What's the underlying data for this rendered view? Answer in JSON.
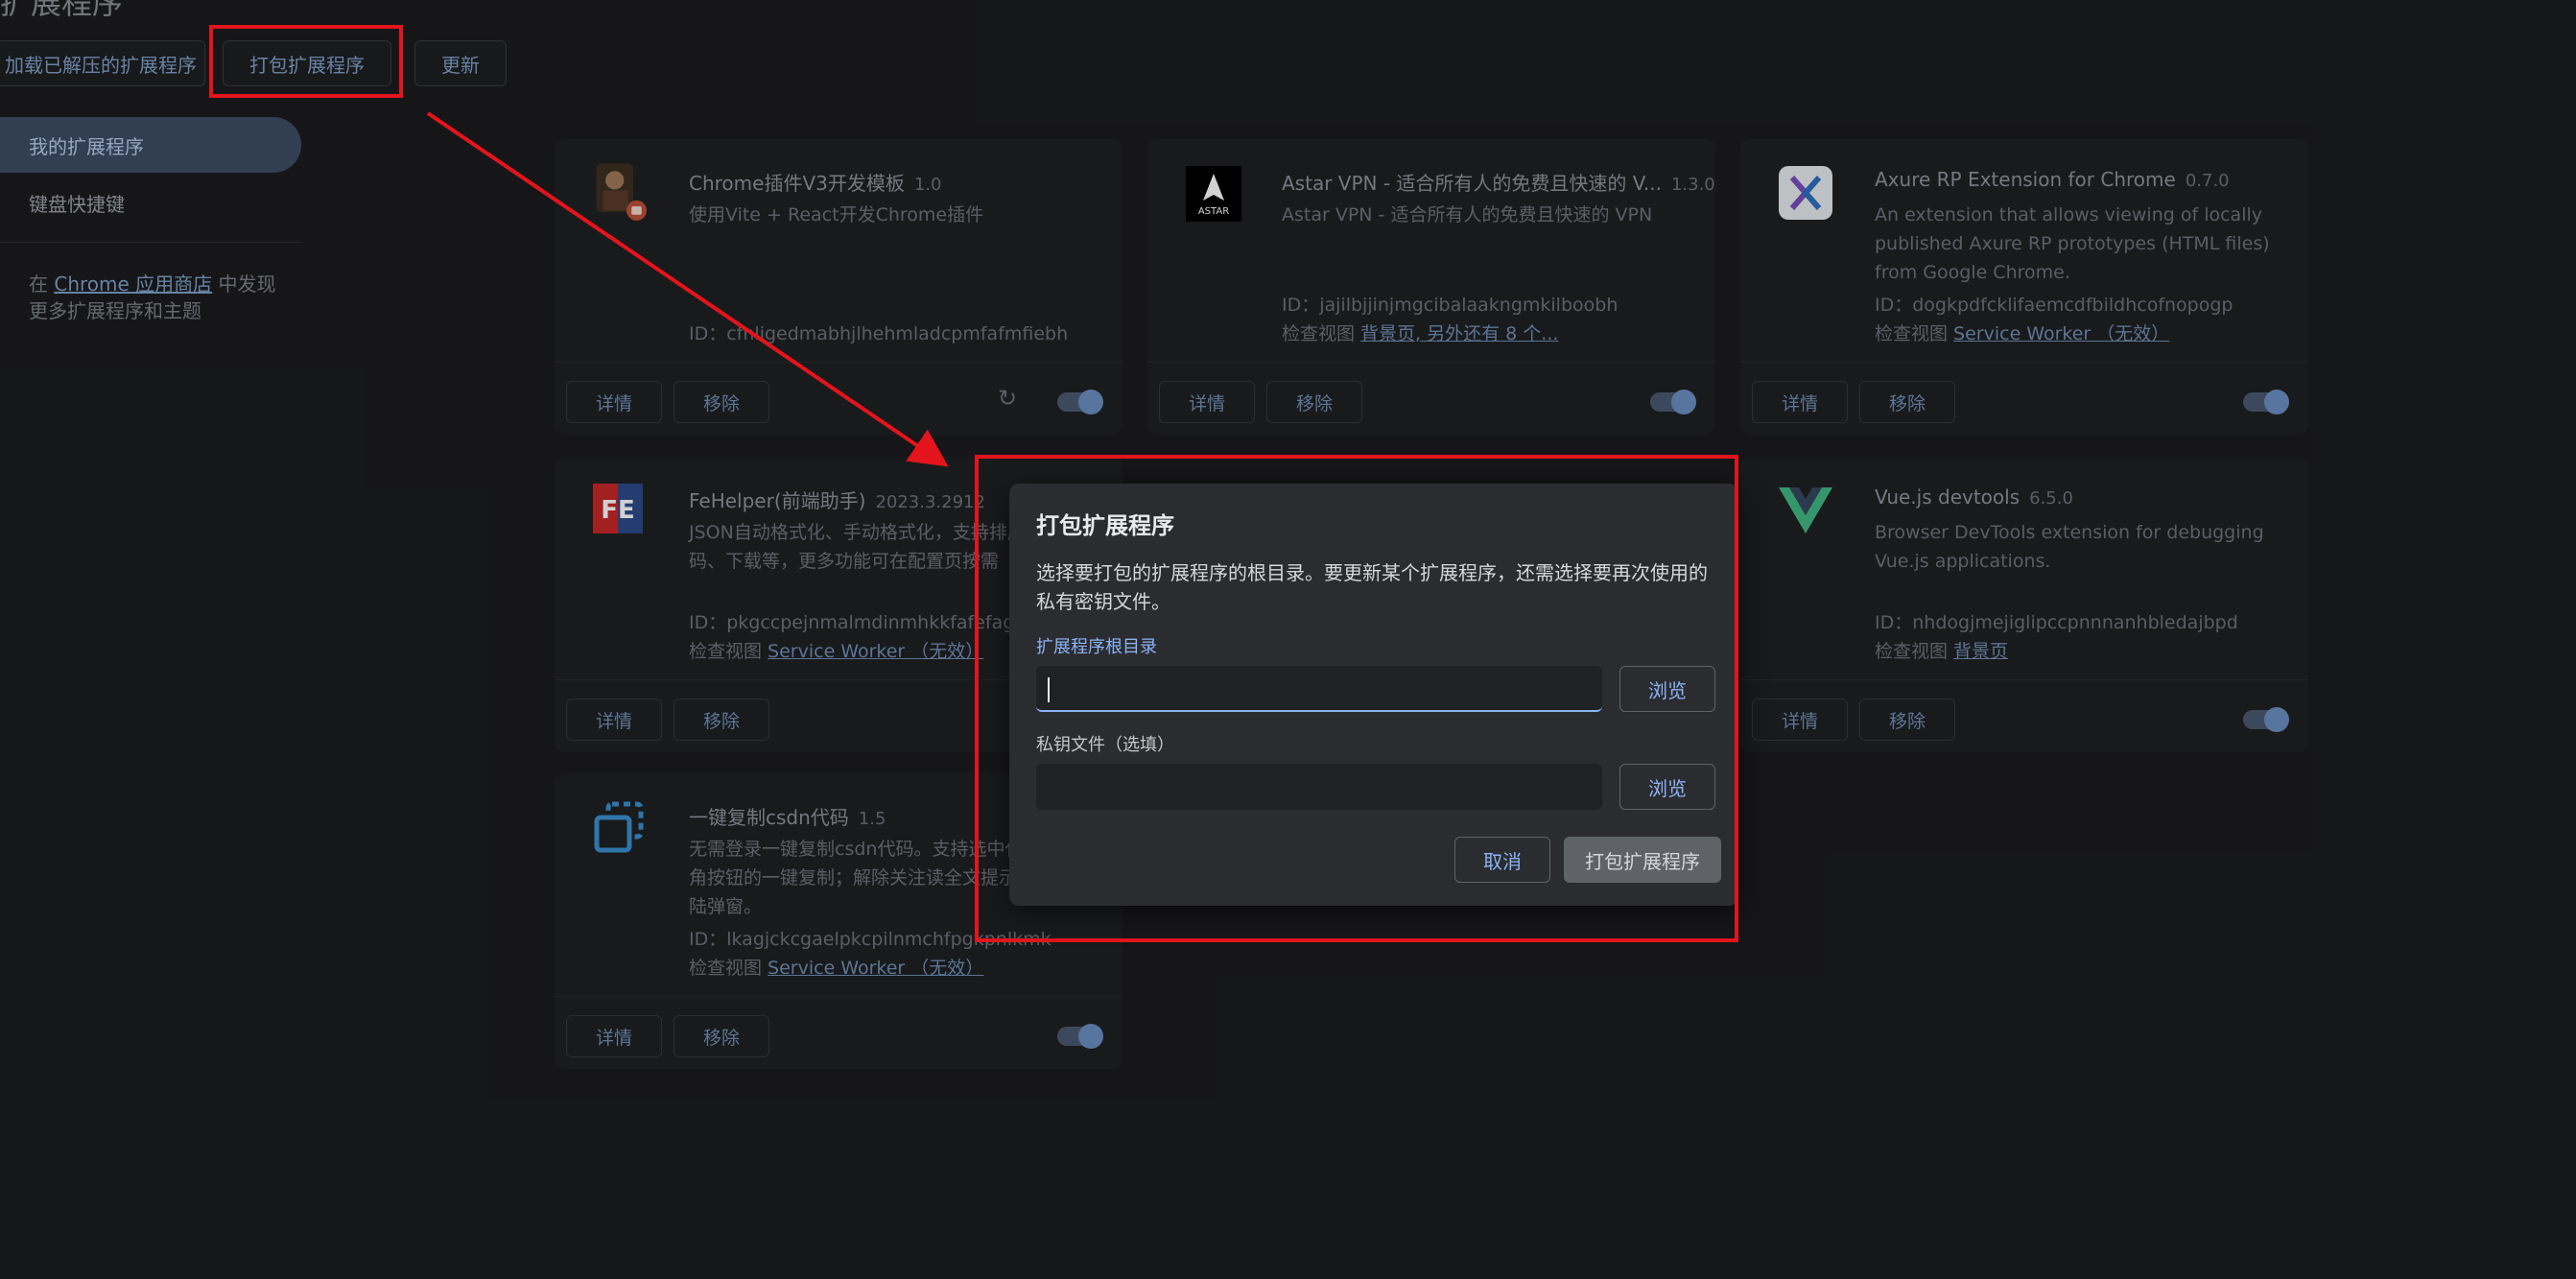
{
  "page": {
    "title": "扩展程序"
  },
  "toolbar": {
    "load_unpacked": "加载已解压的扩展程序",
    "pack_extension": "打包扩展程序",
    "update": "更新"
  },
  "sidebar": {
    "items": [
      {
        "label": "我的扩展程序"
      },
      {
        "label": "键盘快捷键"
      }
    ],
    "note_prefix": "在 ",
    "note_link": "Chrome 应用商店",
    "note_suffix": " 中发现更多扩展程序和主题"
  },
  "card_labels": {
    "details": "详情",
    "remove": "移除",
    "id_prefix": "ID：",
    "inspect_prefix": "检查视图 "
  },
  "extensions": [
    {
      "name": "Chrome插件V3开发模板",
      "version": "1.0",
      "description": "使用Vite + React开发Chrome插件",
      "id": "cfnligedmabhjlhehmladcpmfafmfiebh",
      "views": "",
      "icon": "avatar-icon"
    },
    {
      "name": "Astar VPN - 适合所有人的免费且快速的 V...",
      "version": "1.3.0",
      "description": "Astar VPN - 适合所有人的免费且快速的 VPN",
      "id": "jajilbjjinjmgcibalaakngmkilboobh",
      "views": "背景页, 另外还有 8 个...",
      "icon": "astar-icon",
      "icon_text": "ASTAR"
    },
    {
      "name": "Axure RP Extension for Chrome",
      "version": "0.7.0",
      "description": "An extension that allows viewing of locally published Axure RP prototypes (HTML files) from Google Chrome.",
      "id": "dogkpdfcklifaemcdfbildhcofnopogp",
      "views": "Service Worker （无效）",
      "icon": "axure-icon"
    },
    {
      "name": "FeHelper(前端助手)",
      "version": "2023.3.2912",
      "description": "JSON自动格式化、手动格式化，支持排序、解码、下载等，更多功能可在配置页按需",
      "id": "pkgccpejnmalmdinmhkkfafefagiiia",
      "views": "Service Worker （无效）",
      "icon": "fehelper-icon",
      "icon_text": "FE"
    },
    {
      "name": "Vue.js devtools",
      "version": "6.5.0",
      "description": "Browser DevTools extension for debugging Vue.js applications.",
      "id": "nhdogjmejiglipccpnnnanhbledajbpd",
      "views": "背景页",
      "icon": "vue-icon"
    },
    {
      "name": "一键复制csdn代码",
      "version": "1.5",
      "description": "无需登录一键复制csdn代码。支持选中代码右上角按钮的一键复制；解除关注读全文提示；去除登陆弹窗。",
      "id": "lkagjckcgaelpkcpilnmchfpgkpnlkmk",
      "views": "Service Worker （无效）",
      "icon": "csdn-copy-icon"
    }
  ],
  "dialog": {
    "title": "打包扩展程序",
    "description": "选择要打包的扩展程序的根目录。要更新某个扩展程序，还需选择要再次使用的私有密钥文件。",
    "root_label": "扩展程序根目录",
    "root_value": "",
    "key_label": "私钥文件（选填）",
    "key_value": "",
    "browse": "浏览",
    "cancel": "取消",
    "confirm": "打包扩展程序"
  },
  "colors": {
    "annotation": "#e3141b",
    "accent": "#8ab4f8",
    "background": "#1b1c1e"
  }
}
